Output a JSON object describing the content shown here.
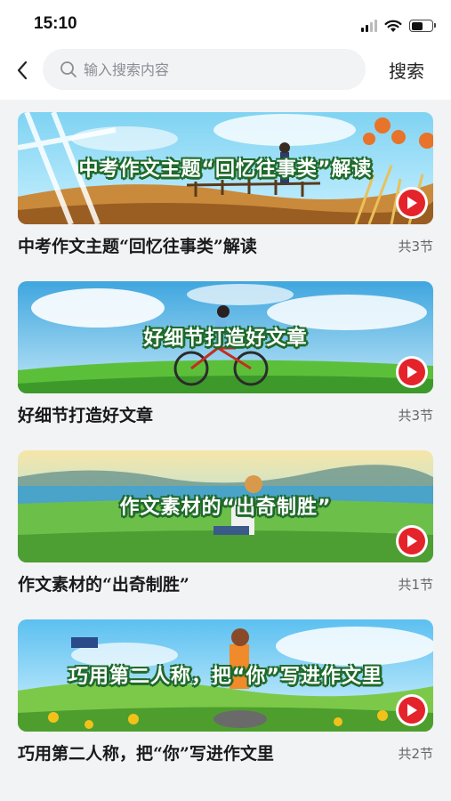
{
  "status_bar": {
    "time": "15:10",
    "battery_level": 0.55
  },
  "header": {
    "search_placeholder": "输入搜索内容",
    "search_button_label": "搜索",
    "icons": {
      "back": "chevron-left-icon",
      "search": "search-icon"
    }
  },
  "courses": [
    {
      "banner_title": "中考作文主题“回忆往事类”解读",
      "title": "中考作文主题“回忆往事类”解读",
      "lessons": "共3节"
    },
    {
      "banner_title": "好细节打造好文章",
      "title": "好细节打造好文章",
      "lessons": "共3节"
    },
    {
      "banner_title": "作文素材的“出奇制胜”",
      "title": "作文素材的“出奇制胜”",
      "lessons": "共1节"
    },
    {
      "banner_title": "巧用第二人称，把“你”写进作文里",
      "title": "巧用第二人称，把“你”写进作文里",
      "lessons": "共2节"
    }
  ],
  "colors": {
    "play_button": "#e4232b",
    "page_background": "#f2f3f5"
  }
}
